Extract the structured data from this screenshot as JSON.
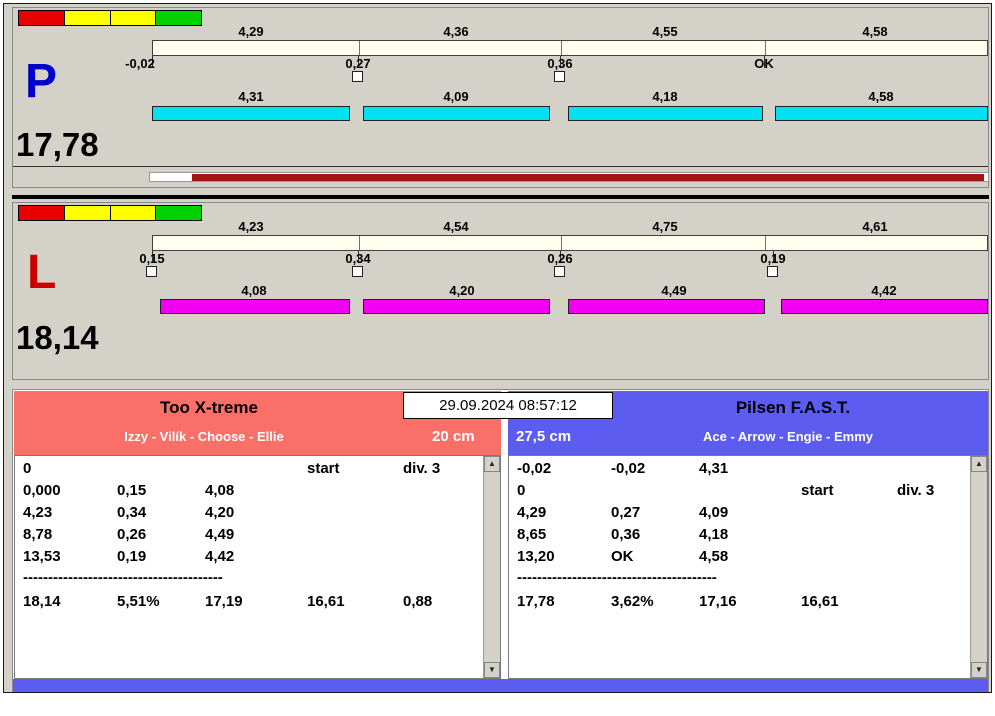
{
  "window": {
    "footer_color": "#5c5cf0"
  },
  "icons": {
    "up_arrow": "▲",
    "down_arrow": "▼"
  },
  "timestamp": "29.09.2024 08:57:12",
  "lanes": [
    {
      "id": "P",
      "letter": "P",
      "letter_color": "#0000cc",
      "total": "17,78",
      "lights": [
        "#e80000",
        "#ffff00",
        "#ffff00",
        "#00d000"
      ],
      "splits_row1": [
        "4,29",
        "4,36",
        "4,55",
        "4,58"
      ],
      "deltas": [
        "-0,02",
        "0,27",
        "0,36",
        "OK"
      ],
      "splits_row2": [
        "4,31",
        "4,09",
        "4,18",
        "4,58"
      ],
      "bar_color": "#00e2f2",
      "progress_fill": "#a31515"
    },
    {
      "id": "L",
      "letter": "L",
      "letter_color": "#cc0000",
      "total": "18,14",
      "lights": [
        "#e80000",
        "#ffff00",
        "#ffff00",
        "#00d000"
      ],
      "splits_row1": [
        "4,23",
        "4,54",
        "4,75",
        "4,61"
      ],
      "deltas": [
        "0,15",
        "0,34",
        "0,26",
        "0,19"
      ],
      "splits_row2": [
        "4,08",
        "4,20",
        "4,49",
        "4,42"
      ],
      "bar_color": "#f200f2"
    }
  ],
  "teams": [
    {
      "name": "Too X-treme",
      "lineup": "Izzy - Vilík - Choose - Ellie",
      "jump_height": "20 cm",
      "header_color": "#fa7068",
      "rows": [
        {
          "c1": "0",
          "c2": "",
          "c3": "",
          "c4": "start",
          "c5": "div. 3"
        },
        {
          "c1": "0,000",
          "c2": "0,15",
          "c3": "4,08",
          "c4": "",
          "c5": ""
        },
        {
          "c1": "4,23",
          "c2": "0,34",
          "c3": "4,20",
          "c4": "",
          "c5": ""
        },
        {
          "c1": "8,78",
          "c2": "0,26",
          "c3": "4,49",
          "c4": "",
          "c5": ""
        },
        {
          "c1": "13,53",
          "c2": "0,19",
          "c3": "4,42",
          "c4": "",
          "c5": ""
        }
      ],
      "separator": "----------------------------------------",
      "total_row": {
        "c1": "18,14",
        "c2": "5,51%",
        "c3": "17,19",
        "c4": "16,61",
        "c5": "0,88"
      }
    },
    {
      "name": "Pilsen F.A.S.T.",
      "lineup": "Ace - Arrow - Engie - Emmy",
      "jump_height": "27,5 cm",
      "header_color": "#5c5cf0",
      "rows": [
        {
          "c1": "-0,02",
          "c2": "-0,02",
          "c3": "4,31",
          "c4": "",
          "c5": ""
        },
        {
          "c1": "0",
          "c2": "",
          "c3": "",
          "c4": "start",
          "c5": "div. 3"
        },
        {
          "c1": "4,29",
          "c2": "0,27",
          "c3": "4,09",
          "c4": "",
          "c5": ""
        },
        {
          "c1": "8,65",
          "c2": "0,36",
          "c3": "4,18",
          "c4": "",
          "c5": ""
        },
        {
          "c1": "13,20",
          "c2": "OK",
          "c3": "4,58",
          "c4": "",
          "c5": ""
        }
      ],
      "separator": "----------------------------------------",
      "total_row": {
        "c1": "17,78",
        "c2": "3,62%",
        "c3": "17,16",
        "c4": "16,61",
        "c5": ""
      }
    }
  ]
}
